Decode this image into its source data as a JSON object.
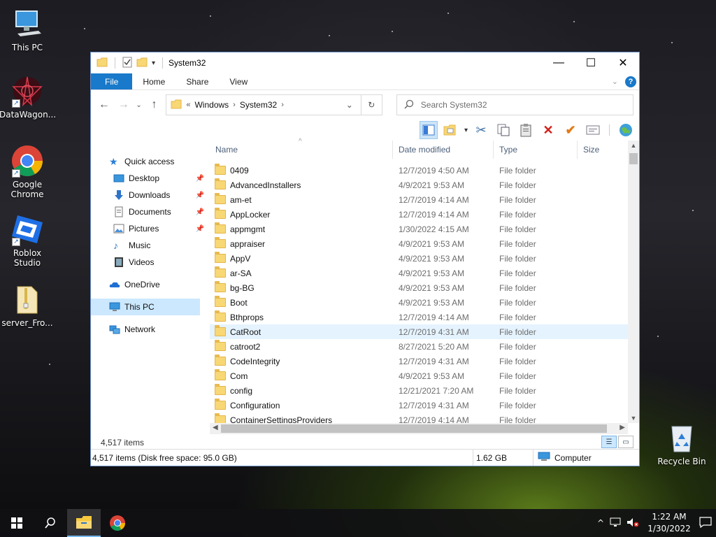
{
  "desktop": {
    "icons": [
      {
        "label": "This PC",
        "icon": "monitor-icon"
      },
      {
        "label": "DataWagon...",
        "icon": "datawagon-app-icon"
      },
      {
        "label": "Google Chrome",
        "icon": "chrome-icon"
      },
      {
        "label": "Roblox Studio",
        "icon": "roblox-studio-icon"
      },
      {
        "label": "server_Fro...",
        "icon": "zip-file-icon"
      },
      {
        "label": "Recycle Bin",
        "icon": "recycle-bin-icon"
      }
    ]
  },
  "window": {
    "title": "System32",
    "controls": {
      "minimize": "—",
      "maximize": "☐",
      "close": "✕"
    },
    "ribbon_tabs": [
      "File",
      "Home",
      "Share",
      "View"
    ],
    "address": {
      "overflow": "«",
      "crumbs": [
        "Windows",
        "System32"
      ]
    },
    "search": {
      "placeholder": "Search System32"
    },
    "nav": {
      "quick_access": "Quick access",
      "items": [
        {
          "label": "Desktop",
          "icon": "desktop-icon",
          "pinned": true
        },
        {
          "label": "Downloads",
          "icon": "downloads-arrow-icon",
          "pinned": true
        },
        {
          "label": "Documents",
          "icon": "documents-icon",
          "pinned": true
        },
        {
          "label": "Pictures",
          "icon": "pictures-icon",
          "pinned": true
        },
        {
          "label": "Music",
          "icon": "music-note-icon",
          "pinned": false
        },
        {
          "label": "Videos",
          "icon": "videos-icon",
          "pinned": false
        }
      ],
      "onedrive": "OneDrive",
      "this_pc": "This PC",
      "network": "Network"
    },
    "columns": {
      "name": "Name",
      "date": "Date modified",
      "type": "Type",
      "size": "Size"
    },
    "files": [
      {
        "name": "0409",
        "date": "12/7/2019 4:50 AM",
        "type": "File folder"
      },
      {
        "name": "AdvancedInstallers",
        "date": "4/9/2021 9:53 AM",
        "type": "File folder"
      },
      {
        "name": "am-et",
        "date": "12/7/2019 4:14 AM",
        "type": "File folder"
      },
      {
        "name": "AppLocker",
        "date": "12/7/2019 4:14 AM",
        "type": "File folder"
      },
      {
        "name": "appmgmt",
        "date": "1/30/2022 4:15 AM",
        "type": "File folder"
      },
      {
        "name": "appraiser",
        "date": "4/9/2021 9:53 AM",
        "type": "File folder"
      },
      {
        "name": "AppV",
        "date": "4/9/2021 9:53 AM",
        "type": "File folder"
      },
      {
        "name": "ar-SA",
        "date": "4/9/2021 9:53 AM",
        "type": "File folder"
      },
      {
        "name": "bg-BG",
        "date": "4/9/2021 9:53 AM",
        "type": "File folder"
      },
      {
        "name": "Boot",
        "date": "4/9/2021 9:53 AM",
        "type": "File folder"
      },
      {
        "name": "Bthprops",
        "date": "12/7/2019 4:14 AM",
        "type": "File folder"
      },
      {
        "name": "CatRoot",
        "date": "12/7/2019 4:31 AM",
        "type": "File folder",
        "hover": true
      },
      {
        "name": "catroot2",
        "date": "8/27/2021 5:20 AM",
        "type": "File folder"
      },
      {
        "name": "CodeIntegrity",
        "date": "12/7/2019 4:31 AM",
        "type": "File folder"
      },
      {
        "name": "Com",
        "date": "4/9/2021 9:53 AM",
        "type": "File folder"
      },
      {
        "name": "config",
        "date": "12/21/2021 7:20 AM",
        "type": "File folder"
      },
      {
        "name": "Configuration",
        "date": "12/7/2019 4:31 AM",
        "type": "File folder"
      },
      {
        "name": "ContainerSettingsProviders",
        "date": "12/7/2019 4:14 AM",
        "type": "File folder"
      }
    ],
    "item_count": "4,517 items",
    "status": {
      "items": "4,517 items (Disk free space: 95.0 GB)",
      "size": "1.62 GB",
      "location": "Computer"
    }
  },
  "taskbar": {
    "clock_time": "1:22 AM",
    "clock_date": "1/30/2022"
  },
  "colors": {
    "accent": "#1979ca",
    "selection": "#cce8ff",
    "folder": "#f8d775"
  }
}
